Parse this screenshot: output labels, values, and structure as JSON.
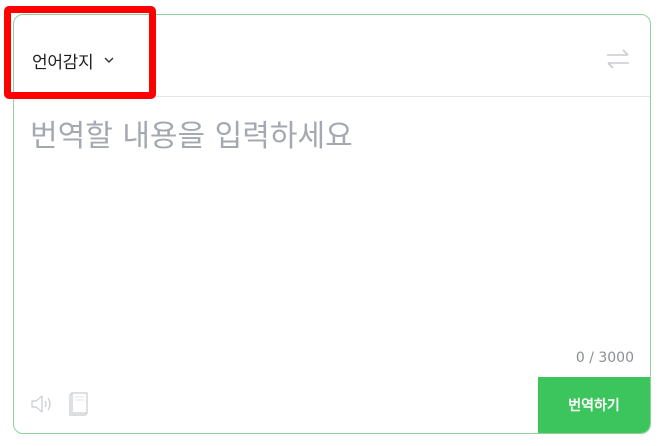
{
  "source_language": {
    "label": "언어감지"
  },
  "input": {
    "placeholder": "번역할 내용을 입력하세요",
    "value": ""
  },
  "char_counter": {
    "text": "0 / 3000"
  },
  "buttons": {
    "translate_label": "번역하기"
  },
  "icons": {
    "dropdown": "chevron-down-icon",
    "swap": "swap-arrows-icon",
    "listen": "speaker-icon",
    "dictionary": "book-icon"
  },
  "colors": {
    "accent": "#3cc55d",
    "panel_border": "#8fd39a",
    "highlight": "#ff0000",
    "placeholder": "#a4a8b0"
  }
}
